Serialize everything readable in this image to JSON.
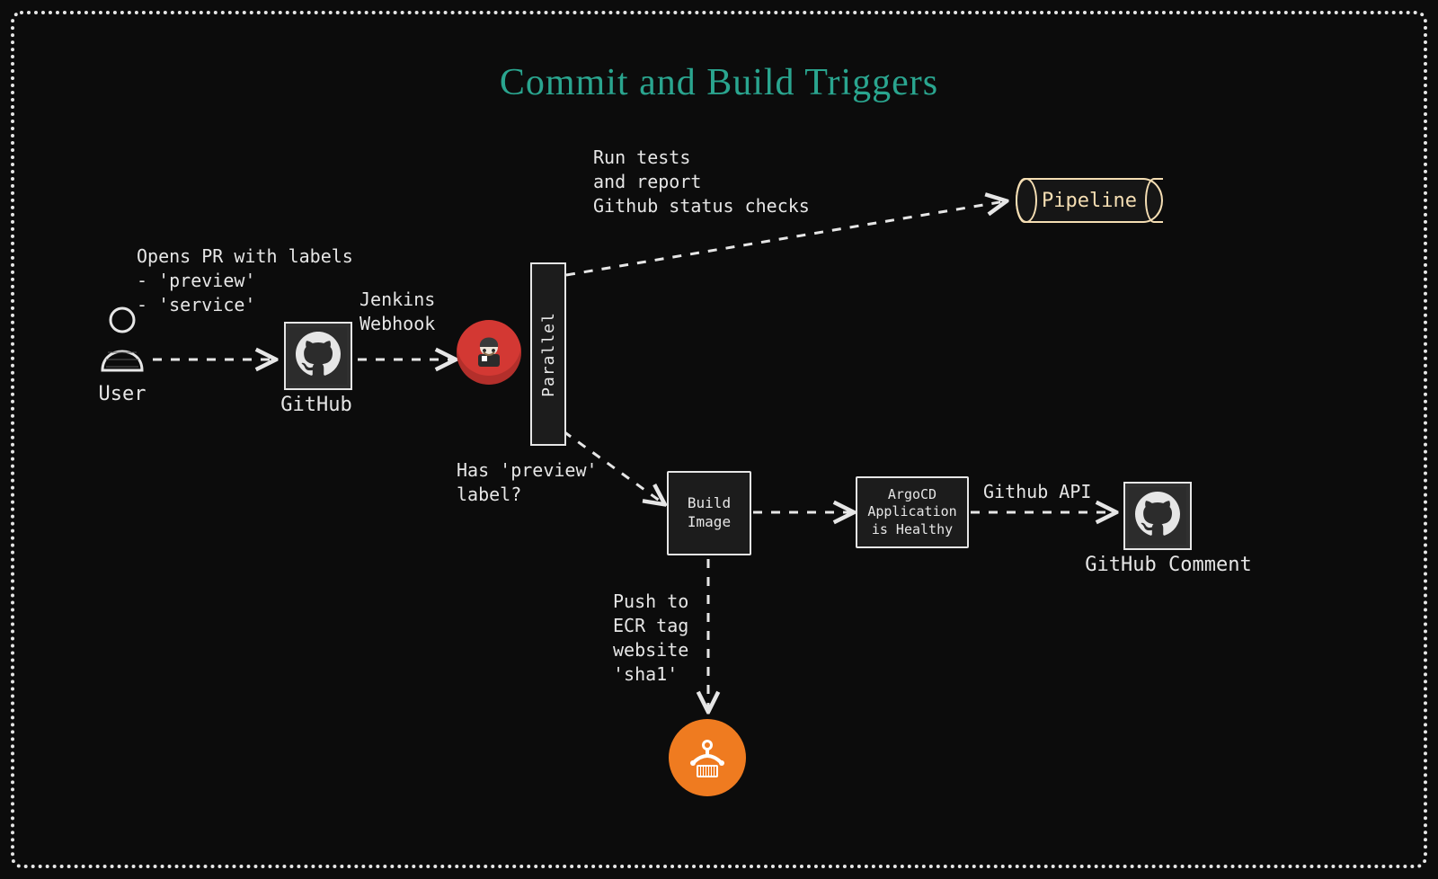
{
  "title": "Commit and Build Triggers",
  "nodes": {
    "user": "User",
    "github": "GitHub",
    "parallel": "Parallel",
    "pipeline": "Pipeline",
    "build_image": "Build\nImage",
    "argocd": "ArgoCD\nApplication\nis Healthy",
    "github_comment": "GitHub Comment"
  },
  "edges": {
    "user_to_github": "Opens PR with labels\n- 'preview'\n- 'service'",
    "github_to_jenkins": "Jenkins\nWebhook",
    "to_pipeline": "Run tests\nand report\nGithub status checks",
    "to_build": "Has 'preview'\nlabel?",
    "build_to_ecr": "Push to\nECR tag\nwebsite\n'sha1'",
    "argocd_to_github": "Github API"
  }
}
